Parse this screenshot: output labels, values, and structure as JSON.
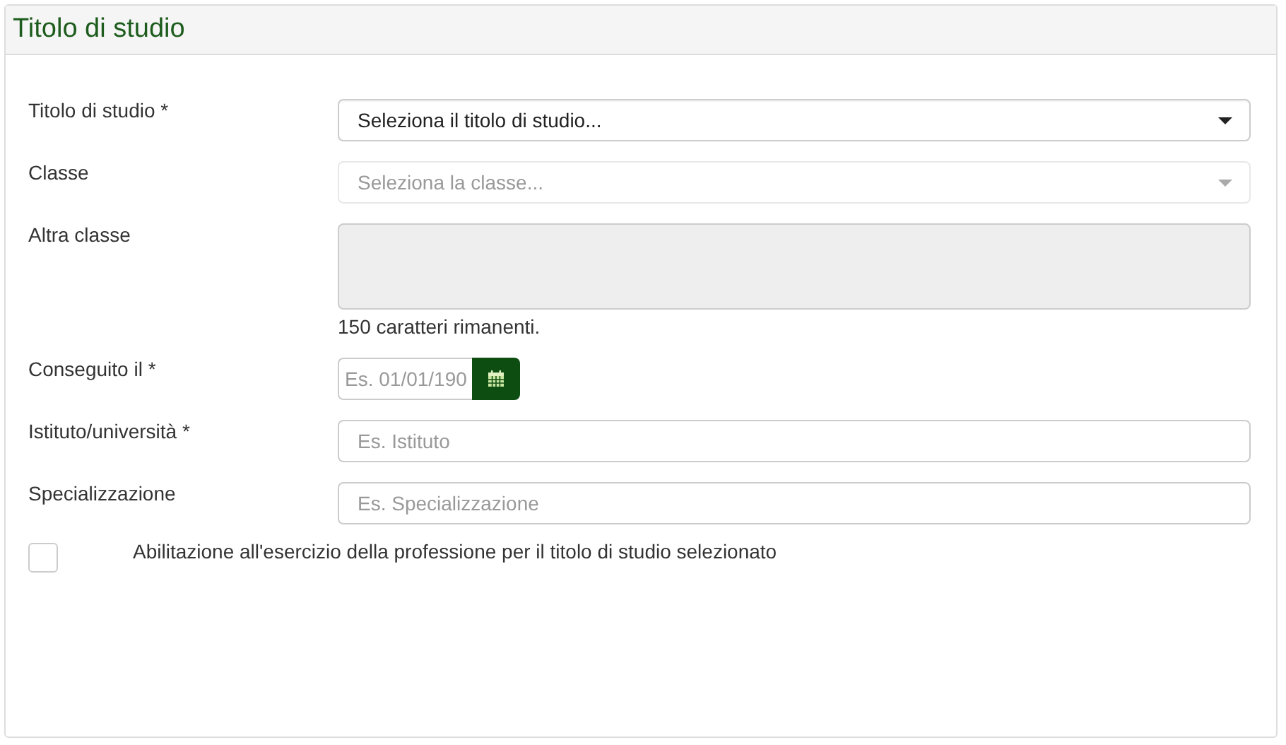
{
  "panel": {
    "title": "Titolo di studio"
  },
  "fields": [
    {
      "kind": "select",
      "label": "Titolo di studio *",
      "placeholder": "Seleziona il titolo di studio...",
      "disabled": false
    },
    {
      "kind": "select",
      "label": "Classe",
      "placeholder": "Seleziona la classe...",
      "disabled": true
    },
    {
      "kind": "textarea",
      "label": "Altra classe",
      "disabled": true,
      "hint": "150 caratteri rimanenti."
    },
    {
      "kind": "date",
      "label": "Conseguito il *",
      "placeholder": "Es. 01/01/190",
      "disabled": false
    },
    {
      "kind": "text",
      "label": "Istituto/università *",
      "placeholder": "Es. Istituto",
      "disabled": false
    },
    {
      "kind": "text",
      "label": "Specializzazione",
      "placeholder": "Es. Specializzazione",
      "disabled": false
    }
  ],
  "checkbox": {
    "label": "Abilitazione all'esercizio della professione per il titolo di studio selezionato",
    "checked": false
  }
}
